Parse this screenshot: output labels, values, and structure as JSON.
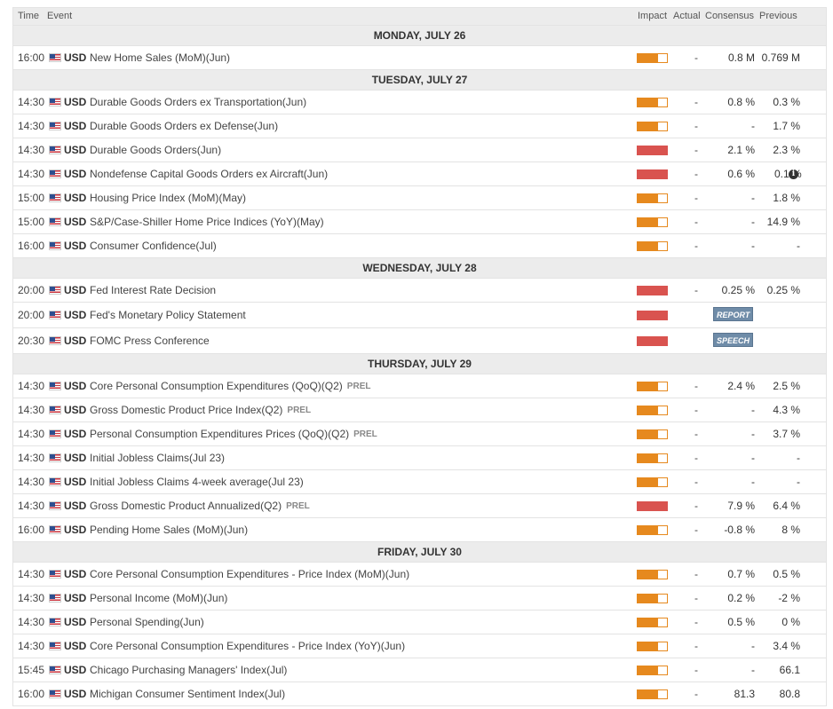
{
  "header": {
    "time": "Time",
    "event": "Event",
    "impact": "Impact",
    "actual": "Actual",
    "consensus": "Consensus",
    "previous": "Previous"
  },
  "colors": {
    "medium": "#e6891e",
    "high": "#d9534f",
    "badge": "#6f8ca8"
  },
  "days": [
    {
      "label": "MONDAY, JULY 26",
      "events": [
        {
          "time": "16:00",
          "currency": "USD",
          "name": "New Home Sales (MoM)(Jun)",
          "prel": "",
          "impact": "medium",
          "actual": "-",
          "consensus": "0.8 M",
          "previous": "0.769 M"
        }
      ]
    },
    {
      "label": "TUESDAY, JULY 27",
      "events": [
        {
          "time": "14:30",
          "currency": "USD",
          "name": "Durable Goods Orders ex Transportation(Jun)",
          "prel": "",
          "impact": "medium",
          "actual": "-",
          "consensus": "0.8 %",
          "previous": "0.3 %"
        },
        {
          "time": "14:30",
          "currency": "USD",
          "name": "Durable Goods Orders ex Defense(Jun)",
          "prel": "",
          "impact": "medium",
          "actual": "-",
          "consensus": "-",
          "previous": "1.7 %"
        },
        {
          "time": "14:30",
          "currency": "USD",
          "name": "Durable Goods Orders(Jun)",
          "prel": "",
          "impact": "high",
          "actual": "-",
          "consensus": "2.1 %",
          "previous": "2.3 %"
        },
        {
          "time": "14:30",
          "currency": "USD",
          "name": "Nondefense Capital Goods Orders ex Aircraft(Jun)",
          "prel": "",
          "impact": "high",
          "actual": "-",
          "consensus": "0.6 %",
          "previous": "0.1 %",
          "info": "i"
        },
        {
          "time": "15:00",
          "currency": "USD",
          "name": "Housing Price Index (MoM)(May)",
          "prel": "",
          "impact": "medium",
          "actual": "-",
          "consensus": "-",
          "previous": "1.8 %"
        },
        {
          "time": "15:00",
          "currency": "USD",
          "name": "S&P/Case-Shiller Home Price Indices (YoY)(May)",
          "prel": "",
          "impact": "medium",
          "actual": "-",
          "consensus": "-",
          "previous": "14.9 %"
        },
        {
          "time": "16:00",
          "currency": "USD",
          "name": "Consumer Confidence(Jul)",
          "prel": "",
          "impact": "medium",
          "actual": "-",
          "consensus": "-",
          "previous": "-"
        }
      ]
    },
    {
      "label": "WEDNESDAY, JULY 28",
      "events": [
        {
          "time": "20:00",
          "currency": "USD",
          "name": "Fed Interest Rate Decision",
          "prel": "",
          "impact": "high",
          "actual": "-",
          "consensus": "0.25 %",
          "previous": "0.25 %"
        },
        {
          "time": "20:00",
          "currency": "USD",
          "name": "Fed's Monetary Policy Statement",
          "prel": "",
          "impact": "high",
          "badge": "REPORT",
          "tall": true
        },
        {
          "time": "20:30",
          "currency": "USD",
          "name": "FOMC Press Conference",
          "prel": "",
          "impact": "high",
          "badge": "SPEECH",
          "tall": true
        }
      ]
    },
    {
      "label": "THURSDAY, JULY 29",
      "events": [
        {
          "time": "14:30",
          "currency": "USD",
          "name": "Core Personal Consumption Expenditures (QoQ)(Q2)",
          "prel": "PREL",
          "impact": "medium",
          "actual": "-",
          "consensus": "2.4 %",
          "previous": "2.5 %"
        },
        {
          "time": "14:30",
          "currency": "USD",
          "name": "Gross Domestic Product Price Index(Q2)",
          "prel": "PREL",
          "impact": "medium",
          "actual": "-",
          "consensus": "-",
          "previous": "4.3 %"
        },
        {
          "time": "14:30",
          "currency": "USD",
          "name": "Personal Consumption Expenditures Prices (QoQ)(Q2)",
          "prel": "PREL",
          "impact": "medium",
          "actual": "-",
          "consensus": "-",
          "previous": "3.7 %"
        },
        {
          "time": "14:30",
          "currency": "USD",
          "name": "Initial Jobless Claims(Jul 23)",
          "prel": "",
          "impact": "medium",
          "actual": "-",
          "consensus": "-",
          "previous": "-"
        },
        {
          "time": "14:30",
          "currency": "USD",
          "name": "Initial Jobless Claims 4-week average(Jul 23)",
          "prel": "",
          "impact": "medium",
          "actual": "-",
          "consensus": "-",
          "previous": "-"
        },
        {
          "time": "14:30",
          "currency": "USD",
          "name": "Gross Domestic Product Annualized(Q2)",
          "prel": "PREL",
          "impact": "high",
          "actual": "-",
          "consensus": "7.9 %",
          "previous": "6.4 %"
        },
        {
          "time": "16:00",
          "currency": "USD",
          "name": "Pending Home Sales (MoM)(Jun)",
          "prel": "",
          "impact": "medium",
          "actual": "-",
          "consensus": "-0.8 %",
          "previous": "8 %"
        }
      ]
    },
    {
      "label": "FRIDAY, JULY 30",
      "events": [
        {
          "time": "14:30",
          "currency": "USD",
          "name": "Core Personal Consumption Expenditures - Price Index (MoM)(Jun)",
          "prel": "",
          "impact": "medium",
          "actual": "-",
          "consensus": "0.7 %",
          "previous": "0.5 %"
        },
        {
          "time": "14:30",
          "currency": "USD",
          "name": "Personal Income (MoM)(Jun)",
          "prel": "",
          "impact": "medium",
          "actual": "-",
          "consensus": "0.2 %",
          "previous": "-2 %"
        },
        {
          "time": "14:30",
          "currency": "USD",
          "name": "Personal Spending(Jun)",
          "prel": "",
          "impact": "medium",
          "actual": "-",
          "consensus": "0.5 %",
          "previous": "0 %"
        },
        {
          "time": "14:30",
          "currency": "USD",
          "name": "Core Personal Consumption Expenditures - Price Index (YoY)(Jun)",
          "prel": "",
          "impact": "medium",
          "actual": "-",
          "consensus": "-",
          "previous": "3.4 %"
        },
        {
          "time": "15:45",
          "currency": "USD",
          "name": "Chicago Purchasing Managers' Index(Jul)",
          "prel": "",
          "impact": "medium",
          "actual": "-",
          "consensus": "-",
          "previous": "66.1"
        },
        {
          "time": "16:00",
          "currency": "USD",
          "name": "Michigan Consumer Sentiment Index(Jul)",
          "prel": "",
          "impact": "medium",
          "actual": "-",
          "consensus": "81.3",
          "previous": "80.8"
        }
      ]
    }
  ]
}
